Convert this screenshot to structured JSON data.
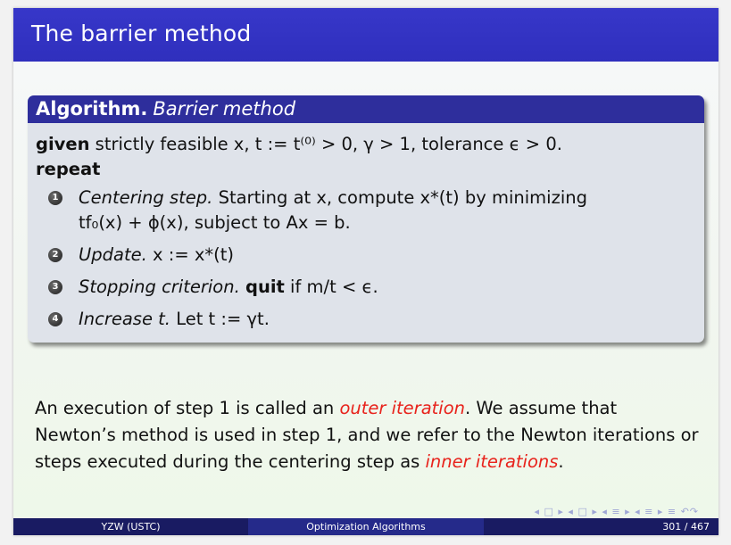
{
  "title": "The barrier method",
  "algorithm": {
    "keyword": "Algorithm.",
    "name": "Barrier method",
    "given_kw": "given",
    "given_rest": " strictly feasible x, t := t⁽⁰⁾ > 0, γ > 1, tolerance ϵ > 0.",
    "repeat_kw": "repeat",
    "steps": [
      {
        "number": "1",
        "label": "Centering step.",
        "text1": " Starting at x, compute x*(t) by minimizing",
        "text2": "tf₀(x) + ϕ(x), subject to Ax = b."
      },
      {
        "number": "2",
        "label": "Update.",
        "text": " x := x*(t)"
      },
      {
        "number": "3",
        "label": "Stopping criterion.",
        "kw": "quit",
        "text": " if m/t < ϵ."
      },
      {
        "number": "4",
        "label": "Increase t.",
        "text": " Let t := γt."
      }
    ]
  },
  "paragraph": {
    "part1": "An execution of step 1 is called an ",
    "outer": "outer iteration",
    "part2": ". We assume that Newton’s method is used in step 1, and we refer to the Newton iterations or steps executed during the centering step as ",
    "inner": "inner iterations",
    "part3": "."
  },
  "nav_symbols": "◂ □ ▸ ◂ □ ▸ ◂ ≡ ▸ ◂ ≡ ▸   ≡   ↶↷",
  "footer": {
    "author": "YZW (USTC)",
    "course": "Optimization Algorithms",
    "page": "301 / 467"
  }
}
